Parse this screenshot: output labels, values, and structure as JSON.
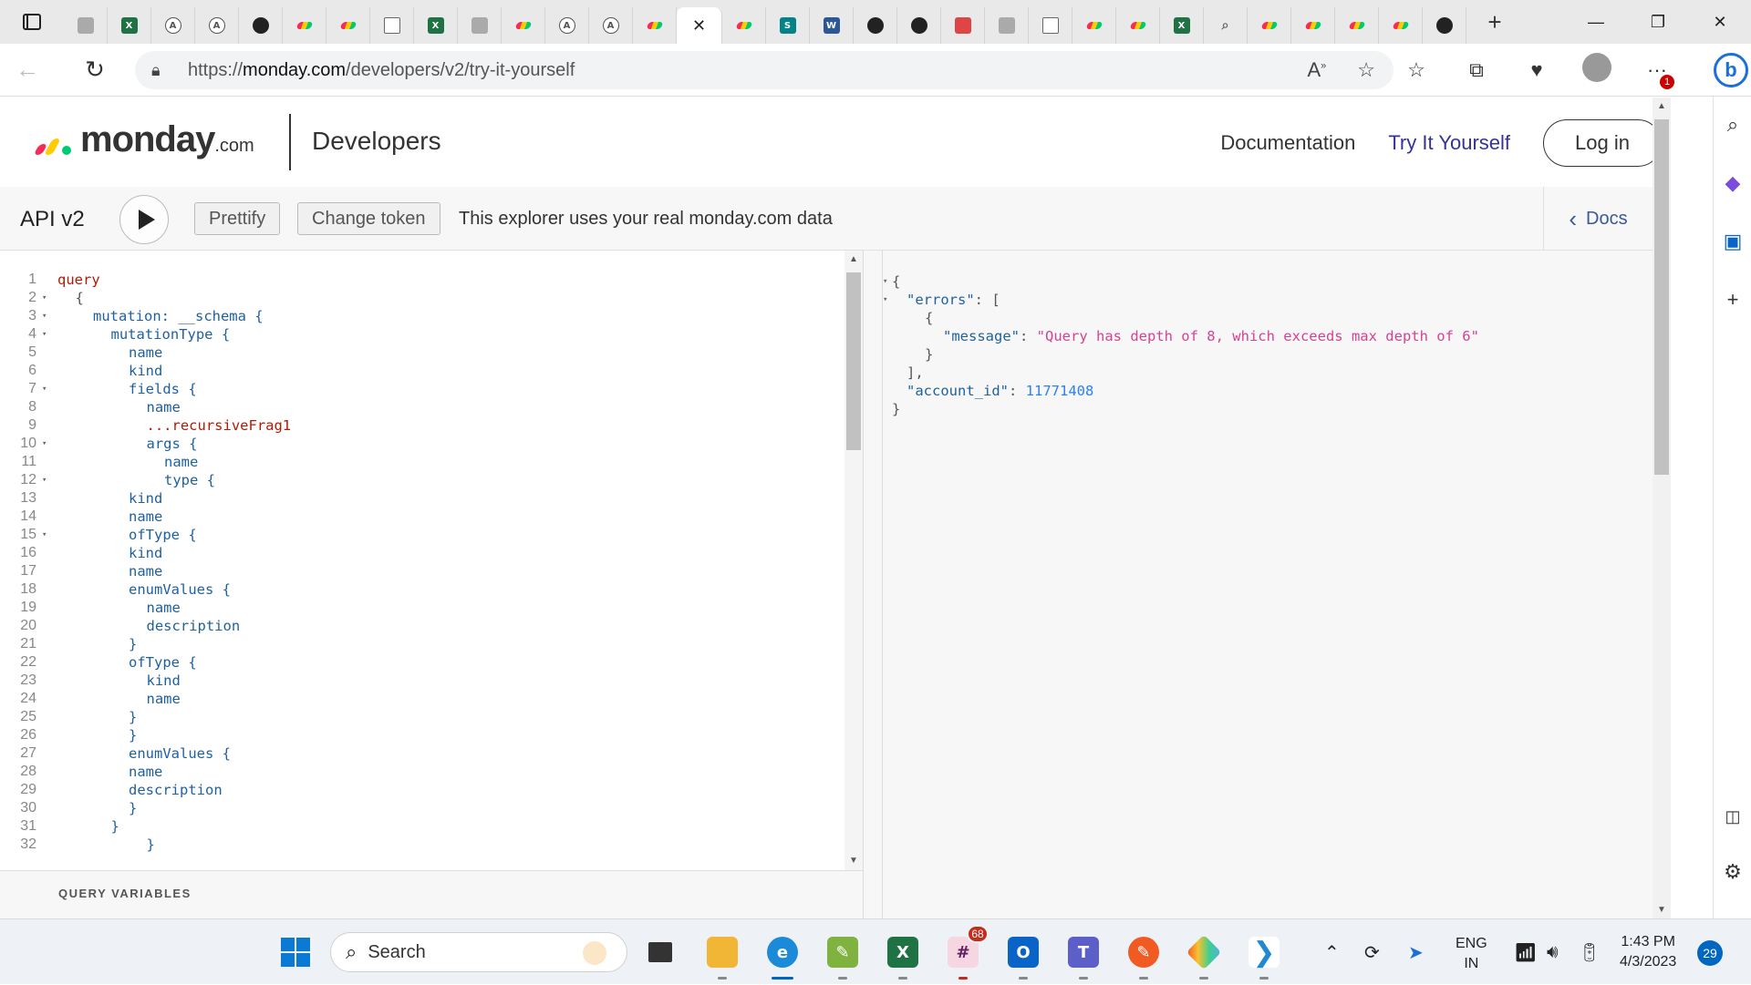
{
  "browser": {
    "url_prefix": "https://",
    "url_domain": "monday.com",
    "url_path": "/developers/v2/try-it-yourself",
    "tabs": [
      {
        "icon": "gray"
      },
      {
        "icon": "excel"
      },
      {
        "icon": "circleA"
      },
      {
        "icon": "circleA"
      },
      {
        "icon": "github"
      },
      {
        "icon": "monday"
      },
      {
        "icon": "monday"
      },
      {
        "icon": "doc"
      },
      {
        "icon": "excel"
      },
      {
        "icon": "gray"
      },
      {
        "icon": "monday"
      },
      {
        "icon": "circleA"
      },
      {
        "icon": "circleA"
      },
      {
        "icon": "monday"
      },
      {
        "icon": "close",
        "active": true
      },
      {
        "icon": "monday"
      },
      {
        "icon": "sp"
      },
      {
        "icon": "word"
      },
      {
        "icon": "github"
      },
      {
        "icon": "github"
      },
      {
        "icon": "red"
      },
      {
        "icon": "gray"
      },
      {
        "icon": "doc"
      },
      {
        "icon": "monday"
      },
      {
        "icon": "monday"
      },
      {
        "icon": "excel"
      },
      {
        "icon": "search"
      },
      {
        "icon": "monday"
      },
      {
        "icon": "monday"
      },
      {
        "icon": "monday"
      },
      {
        "icon": "monday"
      },
      {
        "icon": "github"
      }
    ],
    "notification_badge": "1"
  },
  "header": {
    "logo_text": "monday",
    "logo_suffix": ".com",
    "section": "Developers",
    "nav": {
      "documentation": "Documentation",
      "try_it": "Try It Yourself",
      "login": "Log in"
    }
  },
  "graphiql": {
    "title": "API v2",
    "prettify": "Prettify",
    "change_token": "Change token",
    "note": "This explorer uses your real monday.com data",
    "docs": "Docs",
    "query_variables": "QUERY VARIABLES",
    "editor_lines": [
      {
        "n": "1",
        "fold": false,
        "indent": 0,
        "text": "query",
        "cls": "kw"
      },
      {
        "n": "2",
        "fold": true,
        "indent": 1,
        "text": "{",
        "cls": "punc"
      },
      {
        "n": "3",
        "fold": true,
        "indent": 2,
        "text": "mutation: __schema {",
        "cls": ""
      },
      {
        "n": "4",
        "fold": true,
        "indent": 3,
        "text": "mutationType {",
        "cls": ""
      },
      {
        "n": "5",
        "fold": false,
        "indent": 4,
        "text": "name",
        "cls": ""
      },
      {
        "n": "6",
        "fold": false,
        "indent": 4,
        "text": "kind",
        "cls": ""
      },
      {
        "n": "7",
        "fold": true,
        "indent": 4,
        "text": "fields {",
        "cls": ""
      },
      {
        "n": "8",
        "fold": false,
        "indent": 5,
        "text": "name",
        "cls": ""
      },
      {
        "n": "9",
        "fold": false,
        "indent": 5,
        "text": "...recursiveFrag1",
        "cls": "spread"
      },
      {
        "n": "10",
        "fold": true,
        "indent": 5,
        "text": "args {",
        "cls": ""
      },
      {
        "n": "11",
        "fold": false,
        "indent": 6,
        "text": "name",
        "cls": ""
      },
      {
        "n": "12",
        "fold": true,
        "indent": 6,
        "text": "type {",
        "cls": ""
      },
      {
        "n": "13",
        "fold": false,
        "indent": 4,
        "text": "kind",
        "cls": ""
      },
      {
        "n": "14",
        "fold": false,
        "indent": 4,
        "text": "name",
        "cls": ""
      },
      {
        "n": "15",
        "fold": true,
        "indent": 4,
        "text": "ofType {",
        "cls": ""
      },
      {
        "n": "16",
        "fold": false,
        "indent": 4,
        "text": "kind",
        "cls": ""
      },
      {
        "n": "17",
        "fold": false,
        "indent": 4,
        "text": "name",
        "cls": ""
      },
      {
        "n": "18",
        "fold": false,
        "indent": 4,
        "text": "enumValues {",
        "cls": ""
      },
      {
        "n": "19",
        "fold": false,
        "indent": 5,
        "text": "name",
        "cls": ""
      },
      {
        "n": "20",
        "fold": false,
        "indent": 5,
        "text": "description",
        "cls": ""
      },
      {
        "n": "21",
        "fold": false,
        "indent": 4,
        "text": "}",
        "cls": ""
      },
      {
        "n": "22",
        "fold": false,
        "indent": 4,
        "text": "ofType {",
        "cls": ""
      },
      {
        "n": "23",
        "fold": false,
        "indent": 5,
        "text": "kind",
        "cls": ""
      },
      {
        "n": "24",
        "fold": false,
        "indent": 5,
        "text": "name",
        "cls": ""
      },
      {
        "n": "25",
        "fold": false,
        "indent": 4,
        "text": "}",
        "cls": ""
      },
      {
        "n": "26",
        "fold": false,
        "indent": 4,
        "text": "}",
        "cls": ""
      },
      {
        "n": "27",
        "fold": false,
        "indent": 4,
        "text": "enumValues {",
        "cls": ""
      },
      {
        "n": "28",
        "fold": false,
        "indent": 4,
        "text": "name",
        "cls": ""
      },
      {
        "n": "29",
        "fold": false,
        "indent": 4,
        "text": "description",
        "cls": ""
      },
      {
        "n": "30",
        "fold": false,
        "indent": 4,
        "text": "}",
        "cls": ""
      },
      {
        "n": "31",
        "fold": false,
        "indent": 3,
        "text": "}",
        "cls": ""
      },
      {
        "n": "32",
        "fold": false,
        "indent": 5,
        "text": "}",
        "cls": ""
      }
    ],
    "result": {
      "errors_key": "\"errors\"",
      "message_key": "\"message\"",
      "message_value": "\"Query has depth of 8, which exceeds max depth of 6\"",
      "account_key": "\"account_id\"",
      "account_value": "11771408"
    }
  },
  "taskbar": {
    "search_label": "Search",
    "slack_badge": "68",
    "lang_line1": "ENG",
    "lang_line2": "IN",
    "time": "1:43 PM",
    "date": "4/3/2023",
    "notifications": "29"
  },
  "colors": {
    "accent": "#333399",
    "monday_red": "#f62b54",
    "monday_yellow": "#ffcc00",
    "monday_green": "#00ca72"
  }
}
